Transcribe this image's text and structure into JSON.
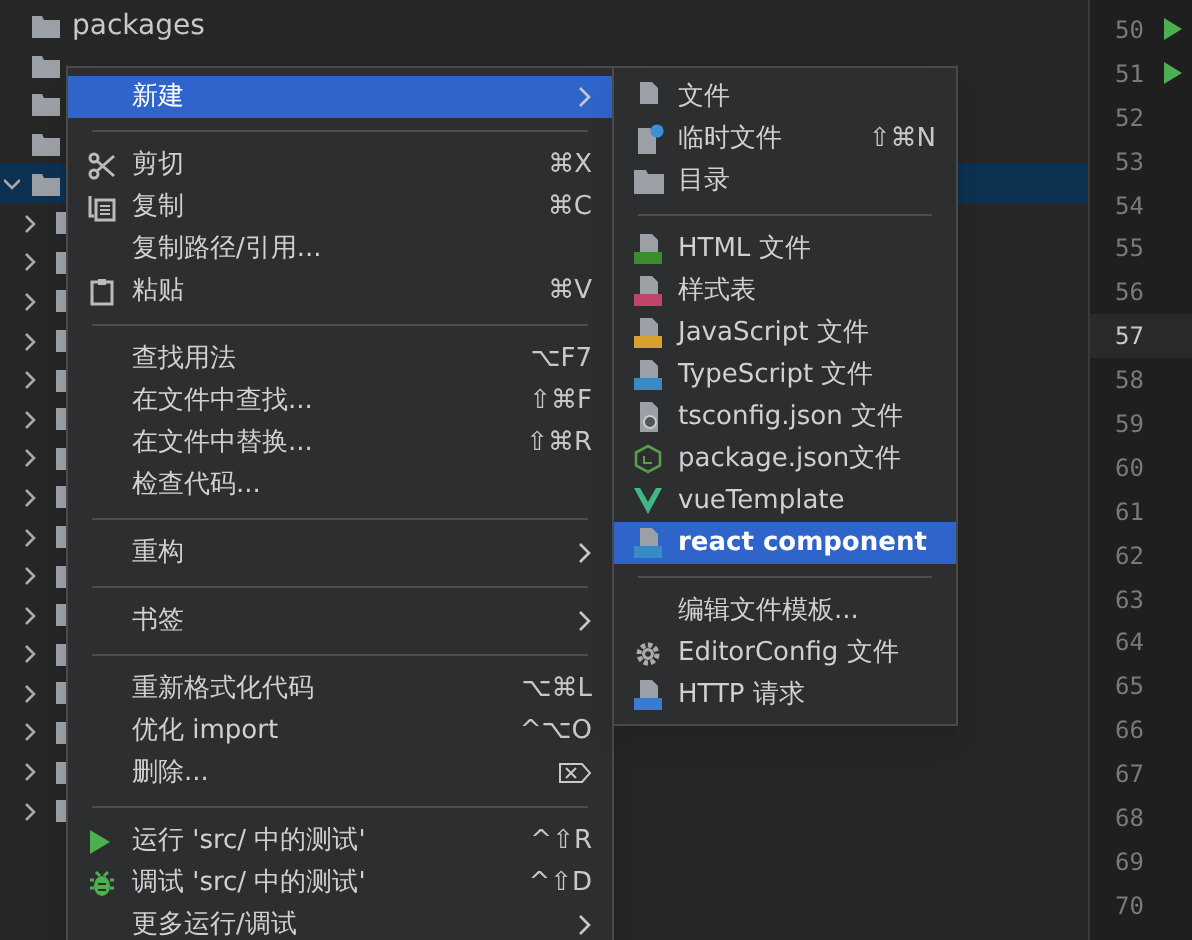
{
  "project_tree": {
    "items": [
      {
        "label": "packages",
        "kind": "folder",
        "selected": false
      },
      {
        "kind": "folder",
        "selected": false
      },
      {
        "kind": "folder",
        "selected": false
      },
      {
        "kind": "folder",
        "selected": false
      },
      {
        "kind": "folder",
        "expanded": true,
        "selected": true
      },
      {
        "kind": "folder",
        "expanded": false,
        "selected": false
      },
      {
        "kind": "folder",
        "expanded": false,
        "selected": false
      },
      {
        "kind": "folder",
        "expanded": false,
        "selected": false
      },
      {
        "kind": "folder",
        "expanded": false,
        "selected": false
      },
      {
        "kind": "folder",
        "expanded": false,
        "selected": false
      },
      {
        "kind": "folder",
        "expanded": false,
        "selected": false
      },
      {
        "kind": "folder",
        "expanded": false,
        "selected": false
      },
      {
        "kind": "folder",
        "expanded": false,
        "selected": false
      },
      {
        "kind": "folder",
        "expanded": false,
        "selected": false
      },
      {
        "kind": "folder",
        "expanded": false,
        "selected": false
      },
      {
        "kind": "folder",
        "expanded": false,
        "selected": false
      },
      {
        "kind": "folder",
        "expanded": false,
        "selected": false
      },
      {
        "kind": "folder",
        "expanded": false,
        "selected": false
      },
      {
        "kind": "folder",
        "expanded": false,
        "selected": false
      },
      {
        "kind": "folder",
        "expanded": false,
        "selected": false
      },
      {
        "kind": "folder",
        "expanded": false,
        "selected": false
      }
    ]
  },
  "editor": {
    "line_numbers": [
      {
        "number": "50",
        "run": true,
        "current": false
      },
      {
        "number": "51",
        "run": true,
        "current": false
      },
      {
        "number": "52",
        "run": false,
        "current": false
      },
      {
        "number": "53",
        "run": false,
        "current": false
      },
      {
        "number": "54",
        "run": false,
        "current": false
      },
      {
        "number": "55",
        "run": false,
        "current": false
      },
      {
        "number": "56",
        "run": false,
        "current": false
      },
      {
        "number": "57",
        "run": false,
        "current": true
      },
      {
        "number": "58",
        "run": false,
        "current": false
      },
      {
        "number": "59",
        "run": false,
        "current": false
      },
      {
        "number": "60",
        "run": false,
        "current": false
      },
      {
        "number": "61",
        "run": false,
        "current": false
      },
      {
        "number": "62",
        "run": false,
        "current": false
      },
      {
        "number": "63",
        "run": false,
        "current": false
      },
      {
        "number": "64",
        "run": false,
        "current": false
      },
      {
        "number": "65",
        "run": false,
        "current": false
      },
      {
        "number": "66",
        "run": false,
        "current": false
      },
      {
        "number": "67",
        "run": false,
        "current": false
      },
      {
        "number": "68",
        "run": false,
        "current": false
      },
      {
        "number": "69",
        "run": false,
        "current": false
      },
      {
        "number": "70",
        "run": false,
        "current": false
      }
    ]
  },
  "context_menu": {
    "items": [
      {
        "kind": "item",
        "label": "新建",
        "submenu": true,
        "selected": true
      },
      {
        "kind": "separator"
      },
      {
        "kind": "item",
        "label": "剪切",
        "shortcut": "⌘X",
        "selected": false
      },
      {
        "kind": "item",
        "label": "复制",
        "shortcut": "⌘C",
        "selected": false
      },
      {
        "kind": "item",
        "label": "复制路径/引用...",
        "selected": false
      },
      {
        "kind": "item",
        "label": "粘贴",
        "shortcut": "⌘V",
        "selected": false
      },
      {
        "kind": "separator"
      },
      {
        "kind": "item",
        "label": "查找用法",
        "shortcut": "⌥F7",
        "selected": false
      },
      {
        "kind": "item",
        "label": "在文件中查找...",
        "shortcut": "⇧⌘F",
        "selected": false
      },
      {
        "kind": "item",
        "label": "在文件中替换...",
        "shortcut": "⇧⌘R",
        "selected": false
      },
      {
        "kind": "item",
        "label": "检查代码...",
        "selected": false
      },
      {
        "kind": "separator"
      },
      {
        "kind": "item",
        "label": "重构",
        "submenu": true,
        "selected": false
      },
      {
        "kind": "separator"
      },
      {
        "kind": "item",
        "label": "书签",
        "submenu": true,
        "selected": false
      },
      {
        "kind": "separator"
      },
      {
        "kind": "item",
        "label": "重新格式化代码",
        "shortcut": "⌥⌘L",
        "selected": false
      },
      {
        "kind": "item",
        "label": "优化 import",
        "shortcut": "^⌥O",
        "selected": false
      },
      {
        "kind": "item",
        "label": "删除...",
        "selected": false
      },
      {
        "kind": "separator"
      },
      {
        "kind": "item",
        "label": "运行 'src/ 中的测试'",
        "shortcut": "^⇧R",
        "selected": false
      },
      {
        "kind": "item",
        "label": "调试 'src/ 中的测试'",
        "shortcut": "^⇧D",
        "selected": false
      },
      {
        "kind": "item",
        "label": "更多运行/调试",
        "submenu": true,
        "selected": false
      }
    ]
  },
  "new_submenu": {
    "items": [
      {
        "kind": "item",
        "label": "文件",
        "selected": false
      },
      {
        "kind": "item",
        "label": "临时文件",
        "shortcut": "⇧⌘N",
        "selected": false
      },
      {
        "kind": "item",
        "label": "目录",
        "selected": false
      },
      {
        "kind": "separator"
      },
      {
        "kind": "item",
        "label": "HTML 文件",
        "selected": false
      },
      {
        "kind": "item",
        "label": "样式表",
        "selected": false
      },
      {
        "kind": "item",
        "label": "JavaScript 文件",
        "selected": false
      },
      {
        "kind": "item",
        "label": "TypeScript 文件",
        "selected": false
      },
      {
        "kind": "item",
        "label": "tsconfig.json 文件",
        "selected": false
      },
      {
        "kind": "item",
        "label": "package.json文件",
        "selected": false
      },
      {
        "kind": "item",
        "label": "vueTemplate",
        "selected": false
      },
      {
        "kind": "item",
        "label": "react component",
        "selected": true
      },
      {
        "kind": "separator"
      },
      {
        "kind": "item",
        "label": "编辑文件模板...",
        "selected": false
      },
      {
        "kind": "item",
        "label": "EditorConfig 文件",
        "selected": false
      },
      {
        "kind": "item",
        "label": "HTTP 请求",
        "selected": false
      }
    ]
  }
}
